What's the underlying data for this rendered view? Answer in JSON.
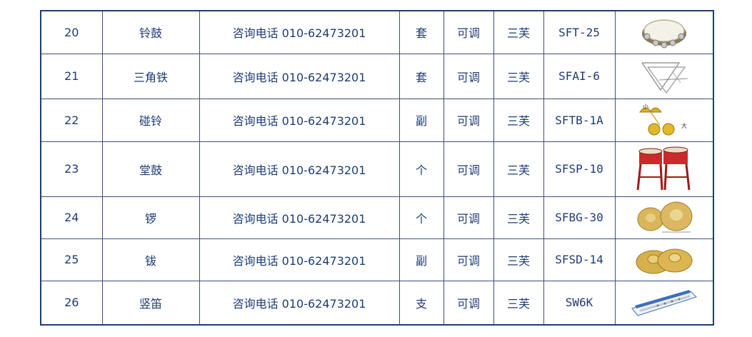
{
  "table": {
    "rows": [
      {
        "no": "20",
        "name": "铃鼓",
        "contact": "咨询电话 010-62473201",
        "unit": "套",
        "adjust": "可调",
        "brand": "三芙",
        "model": "SFT-25",
        "image": "tambourine-icon"
      },
      {
        "no": "21",
        "name": "三角铁",
        "contact": "咨询电话 010-62473201",
        "unit": "套",
        "adjust": "可调",
        "brand": "三芙",
        "model": "SFAI-6",
        "image": "triangle-icon"
      },
      {
        "no": "22",
        "name": "碰铃",
        "contact": "咨询电话 010-62473201",
        "unit": "副",
        "adjust": "可调",
        "brand": "三芙",
        "model": "SFTB-1A",
        "image": "hand-bells-icon",
        "image_text": [
          "小",
          "大"
        ]
      },
      {
        "no": "23",
        "name": "堂鼓",
        "contact": "咨询电话 010-62473201",
        "unit": "个",
        "adjust": "可调",
        "brand": "三芙",
        "model": "SFSP-10",
        "image": "tang-drum-icon"
      },
      {
        "no": "24",
        "name": "锣",
        "contact": "咨询电话 010-62473201",
        "unit": "个",
        "adjust": "可调",
        "brand": "三芙",
        "model": "SFBG-30",
        "image": "gong-icon"
      },
      {
        "no": "25",
        "name": "钹",
        "contact": "咨询电话 010-62473201",
        "unit": "副",
        "adjust": "可调",
        "brand": "三芙",
        "model": "SFSD-14",
        "image": "cymbals-icon"
      },
      {
        "no": "26",
        "name": "竖笛",
        "contact": "咨询电话 010-62473201",
        "unit": "支",
        "adjust": "可调",
        "brand": "三芙",
        "model": "SW6K",
        "image": "recorder-icon"
      }
    ]
  },
  "colors": {
    "text": "#1f3c74",
    "border": "#1f3c74"
  }
}
